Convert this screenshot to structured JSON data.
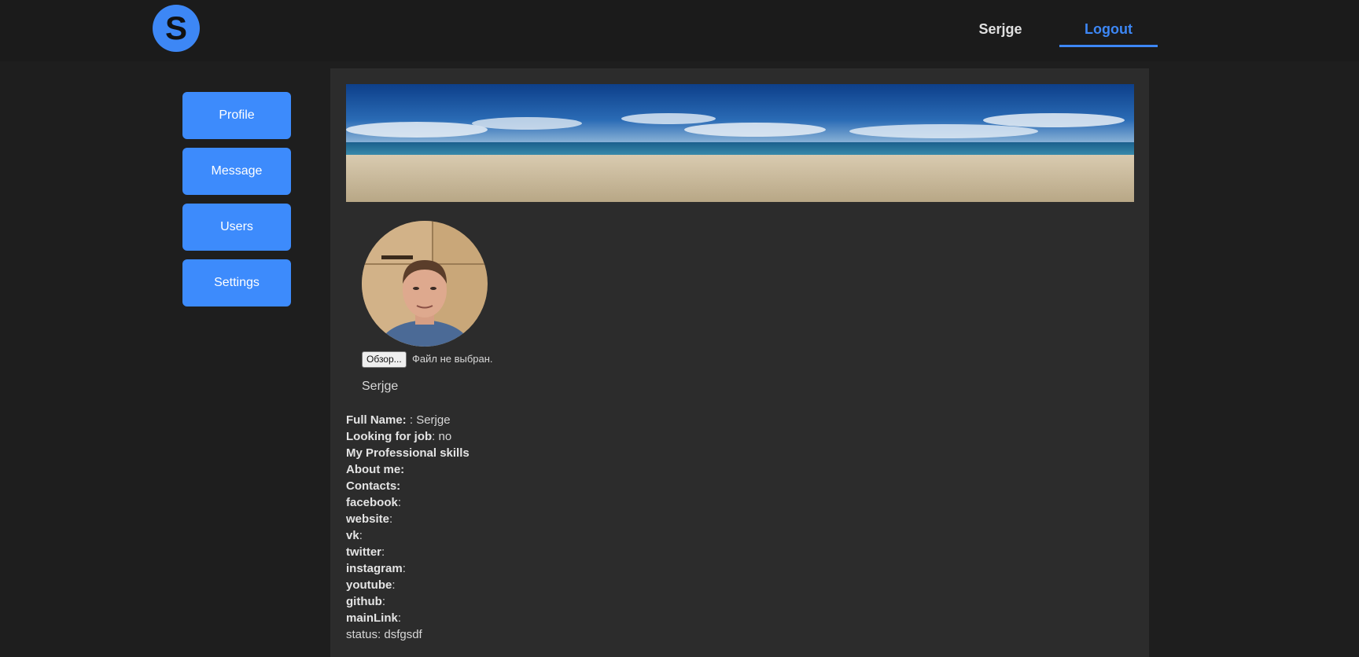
{
  "header": {
    "logo_letter": "S",
    "user_name": "Serjge",
    "logout_label": "Logout",
    "accent_color": "#3d87f5"
  },
  "sidebar": {
    "items": [
      {
        "label": "Profile"
      },
      {
        "label": "Message"
      },
      {
        "label": "Users"
      },
      {
        "label": "Settings"
      }
    ]
  },
  "profile": {
    "file_button_label": "Обзор...",
    "file_status": "Файл не выбран.",
    "name_status": "Serjge",
    "full_name_label": "Full Name:",
    "full_name_value": ": Serjge",
    "looking_for_job_label": "Looking for job",
    "looking_for_job_value": ": no",
    "skills_label": "My Professional skills",
    "about_label": "About me:",
    "contacts_label": "Contacts:",
    "contacts": [
      {
        "label": "facebook",
        "value": ":"
      },
      {
        "label": "website",
        "value": ":"
      },
      {
        "label": "vk",
        "value": ":"
      },
      {
        "label": "twitter",
        "value": ":"
      },
      {
        "label": "instagram",
        "value": ":"
      },
      {
        "label": "youtube",
        "value": ":"
      },
      {
        "label": "github",
        "value": ":"
      },
      {
        "label": "mainLink",
        "value": ":"
      }
    ],
    "status_text": "status: dsfgsdf"
  }
}
